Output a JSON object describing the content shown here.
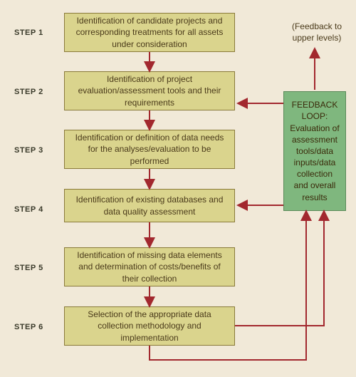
{
  "steps": [
    {
      "label": "STEP 1",
      "text": "Identification of candidate projects and corresponding treatments for all assets under consideration"
    },
    {
      "label": "STEP 2",
      "text": "Identification of project evaluation/assessment tools and their requirements"
    },
    {
      "label": "STEP 3",
      "text": "Identification or definition of data needs for the analyses/evaluation to be performed"
    },
    {
      "label": "STEP 4",
      "text": "Identification of existing databases and data quality assessment"
    },
    {
      "label": "STEP 5",
      "text": "Identification of missing data elements and determination of costs/benefits of their collection"
    },
    {
      "label": "STEP 6",
      "text": "Selection of the appropriate data collection methodology and implementation"
    }
  ],
  "feedback_note": "(Feedback to upper levels)",
  "feedback_box": "FEEDBACK LOOP: Evaluation of assessment tools/data inputs/data collection and overall results",
  "colors": {
    "background": "#f1e9d8",
    "step_box_bg": "#dad48d",
    "step_box_border": "#8a7a3a",
    "feedback_bg": "#7fb77e",
    "feedback_border": "#5a8a59",
    "arrow": "#a2282e"
  }
}
